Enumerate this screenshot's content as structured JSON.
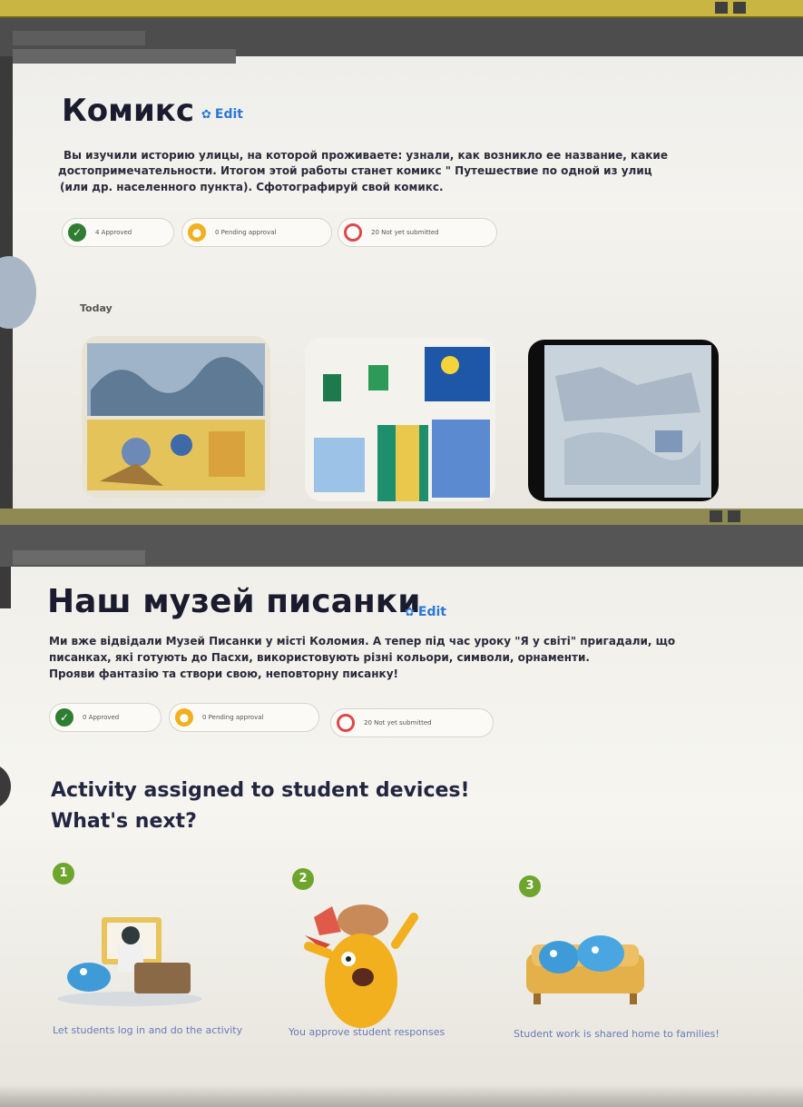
{
  "top_screen": {
    "title": "Комикс",
    "edit_label": "Edit",
    "description": [
      "Вы изучили историю улицы, на которой проживаете: узнали, как возникло ее название,  какие",
      "достопримечательности. Итогом этой работы станет комикс \" Путешествие по одной из улиц",
      "(или др. населенного пункта).  Сфотографируй свой комикс."
    ],
    "status_pills": [
      {
        "label": "4 Approved",
        "color": "green"
      },
      {
        "label": "0 Pending approval",
        "color": "yellow"
      },
      {
        "label": "20 Not yet submitted",
        "color": "red"
      }
    ],
    "today_label": "Today"
  },
  "bottom_screen": {
    "title": "Наш музей писанки",
    "edit_label": "Edit",
    "description": [
      "Ми вже відвідали Музей Писанки у місті Коломия. А тепер під час уроку \"Я у світі\" пригадали, що",
      "писанках, які готують до Пасхи, використовують різні кольори, символи, орнаменти.",
      "Прояви фантазію та створи свою, неповторну писанку!"
    ],
    "status_pills": [
      {
        "label": "0 Approved",
        "color": "green"
      },
      {
        "label": "0 Pending approval",
        "color": "yellow"
      },
      {
        "label": "20 Not yet submitted",
        "color": "red"
      }
    ],
    "assigned_heading": "Activity assigned to student devices!",
    "whats_next": "What's next?",
    "steps": [
      {
        "number": "1",
        "caption": "Let students log in and do the activity"
      },
      {
        "number": "2",
        "caption": "You approve student responses"
      },
      {
        "number": "3",
        "caption": "Student work is shared home to families!"
      }
    ]
  },
  "colors": {
    "browser_bar": "#c9b642",
    "edit_link": "#2b78d6",
    "approved": "#2e7d32",
    "pending": "#f2b01e",
    "not_submitted": "#e04848",
    "step_badge": "#6ea52c"
  }
}
